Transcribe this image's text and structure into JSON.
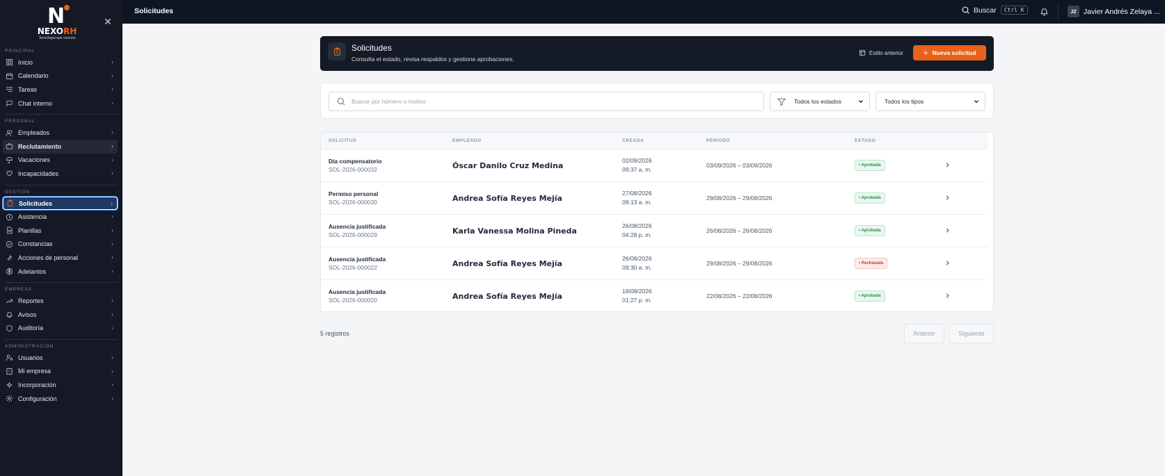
{
  "brand": {
    "logo_letter": "N",
    "logo_word_a": "NEXO",
    "logo_word_b": "RH",
    "tagline": "Tecnología que conecta",
    "accent": "#e8621a"
  },
  "sidebar": {
    "close_icon": "close-icon",
    "sections": [
      {
        "label": "PRINCIPAL",
        "items": [
          {
            "label": "Inicio",
            "icon": "grid-icon"
          },
          {
            "label": "Calendario",
            "icon": "calendar-icon"
          },
          {
            "label": "Tareas",
            "icon": "list-icon"
          },
          {
            "label": "Chat interno",
            "icon": "chat-icon"
          }
        ]
      },
      {
        "label": "PERSONAL",
        "items": [
          {
            "label": "Empleados",
            "icon": "users-icon"
          },
          {
            "label": "Reclutamiento",
            "icon": "briefcase-icon",
            "state": "hover"
          },
          {
            "label": "Vacaciones",
            "icon": "umbrella-icon"
          },
          {
            "label": "Incapacidades",
            "icon": "heart-icon"
          }
        ]
      },
      {
        "label": "GESTIÓN",
        "items": [
          {
            "label": "Solicitudes",
            "icon": "clipboard-icon",
            "state": "active"
          },
          {
            "label": "Asistencia",
            "icon": "clock-icon"
          },
          {
            "label": "Planillas",
            "icon": "document-icon"
          },
          {
            "label": "Constancias",
            "icon": "badge-icon"
          },
          {
            "label": "Acciones de personal",
            "icon": "wrench-icon"
          },
          {
            "label": "Adelantos",
            "icon": "dollar-icon"
          }
        ]
      },
      {
        "label": "EMPRESA",
        "items": [
          {
            "label": "Reportes",
            "icon": "chart-icon"
          },
          {
            "label": "Avisos",
            "icon": "bell-icon"
          },
          {
            "label": "Auditoría",
            "icon": "shield-icon"
          }
        ]
      },
      {
        "label": "ADMINISTRACIÓN",
        "items": [
          {
            "label": "Usuarios",
            "icon": "user-cog-icon"
          },
          {
            "label": "Mi empresa",
            "icon": "building-icon"
          },
          {
            "label": "Incorporación",
            "icon": "sparkle-icon"
          },
          {
            "label": "Configuración",
            "icon": "gear-icon"
          }
        ]
      }
    ]
  },
  "topbar": {
    "title": "Solicitudes",
    "search_label": "Buscar",
    "search_shortcut": "Ctrl K",
    "user_initials": "JZ",
    "user_name": "Javier Andrés Zelaya ..."
  },
  "header": {
    "title": "Solicitudes",
    "subtitle": "Consulta el estado, revisa respaldos y gestiona aprobaciones.",
    "old_style_label": "Estilo anterior",
    "new_button_label": "Nueva solicitud"
  },
  "filters": {
    "search_placeholder": "Buscar por número o motivo",
    "states_value": "Todos los estados",
    "types_value": "Todos los tipos"
  },
  "table": {
    "columns": [
      "SOLICITUD",
      "EMPLEADO",
      "CREADA",
      "PERÍODO",
      "ESTADO"
    ],
    "rows": [
      {
        "type": "Día compensatorio",
        "code": "SOL-2026-000032",
        "employee": "Óscar Danilo Cruz Medina",
        "date": "02/09/2026",
        "time": "09:37 a. m.",
        "period": "03/09/2026 – 03/09/2026",
        "status": "• Aprobada",
        "status_kind": "ok"
      },
      {
        "type": "Permiso personal",
        "code": "SOL-2026-000030",
        "employee": "Andrea Sofía Reyes Mejía",
        "date": "27/08/2026",
        "time": "09:13 a. m.",
        "period": "29/08/2026 – 29/08/2026",
        "status": "• Aprobada",
        "status_kind": "ok"
      },
      {
        "type": "Ausencia justificada",
        "code": "SOL-2026-000029",
        "employee": "Karla Vanessa Molina Pineda",
        "date": "26/08/2026",
        "time": "04:28 p. m.",
        "period": "26/08/2026 – 26/08/2026",
        "status": "• Aprobada",
        "status_kind": "ok"
      },
      {
        "type": "Ausencia justificada",
        "code": "SOL-2026-000022",
        "employee": "Andrea Sofía Reyes Mejía",
        "date": "26/08/2026",
        "time": "09:30 a. m.",
        "period": "29/08/2026 – 29/08/2026",
        "status": "• Rechazada",
        "status_kind": "bad"
      },
      {
        "type": "Ausencia justificada",
        "code": "SOL-2026-000020",
        "employee": "Andrea Sofía Reyes Mejía",
        "date": "18/08/2026",
        "time": "01:27 p. m.",
        "period": "22/08/2026 – 22/08/2026",
        "status": "• Aprobada",
        "status_kind": "ok"
      }
    ]
  },
  "footer": {
    "count": "5 registros",
    "prev_label": "Anterior",
    "next_label": "Siguiente"
  }
}
